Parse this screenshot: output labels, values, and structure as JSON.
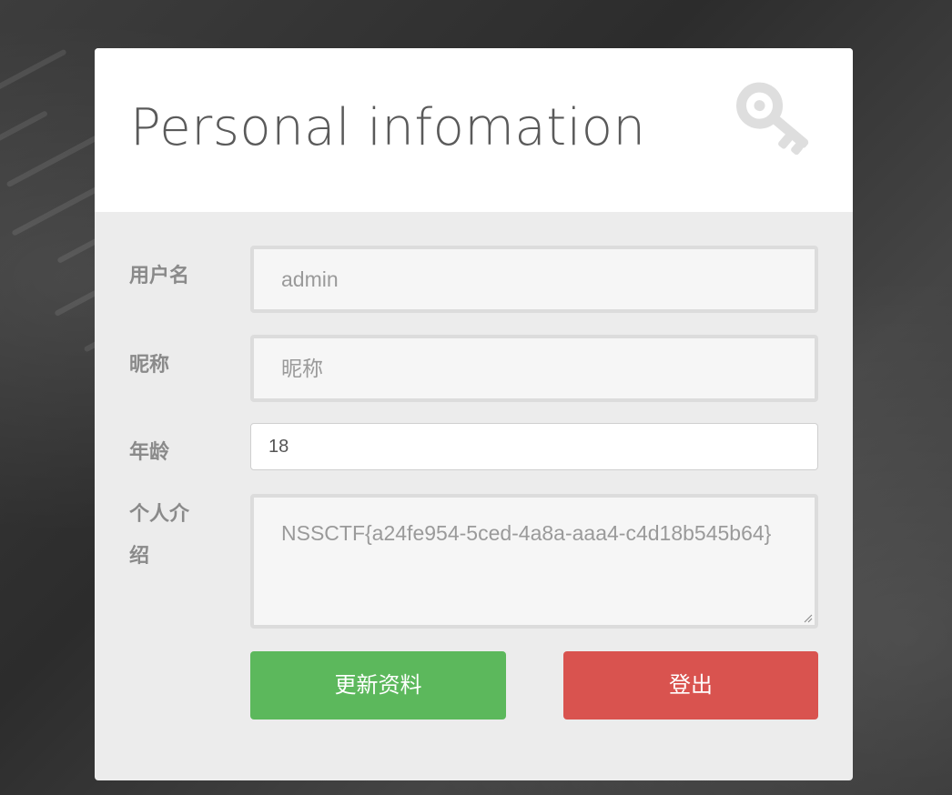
{
  "header": {
    "title": "Personal infomation",
    "icon": "key-icon"
  },
  "form": {
    "username": {
      "label": "用户名",
      "value": "admin"
    },
    "nickname": {
      "label": "昵称",
      "placeholder": "昵称"
    },
    "age": {
      "label": "年龄",
      "value": "18"
    },
    "bio": {
      "label_line1": "个人介",
      "label_line2": "绍",
      "value": "NSSCTF{a24fe954-5ced-4a8a-aaa4-c4d18b545b64}"
    }
  },
  "actions": {
    "update_label": "更新资料",
    "logout_label": "登出"
  },
  "colors": {
    "update": "#5cb85c",
    "logout": "#d9534f"
  }
}
